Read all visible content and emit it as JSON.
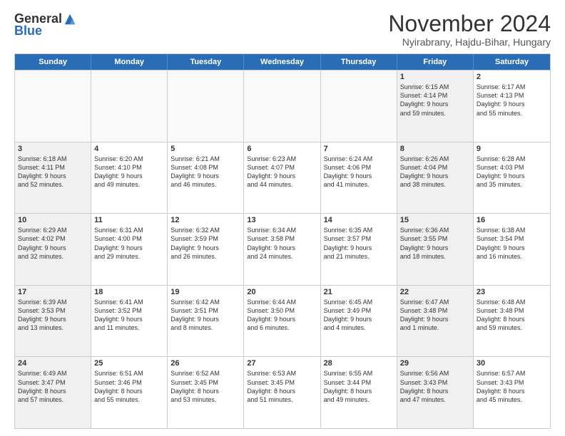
{
  "header": {
    "logo_general": "General",
    "logo_blue": "Blue",
    "title": "November 2024",
    "location": "Nyirabrany, Hajdu-Bihar, Hungary"
  },
  "weekdays": [
    "Sunday",
    "Monday",
    "Tuesday",
    "Wednesday",
    "Thursday",
    "Friday",
    "Saturday"
  ],
  "rows": [
    [
      {
        "day": "",
        "info": "",
        "empty": true
      },
      {
        "day": "",
        "info": "",
        "empty": true
      },
      {
        "day": "",
        "info": "",
        "empty": true
      },
      {
        "day": "",
        "info": "",
        "empty": true
      },
      {
        "day": "",
        "info": "",
        "empty": true
      },
      {
        "day": "1",
        "info": "Sunrise: 6:15 AM\nSunset: 4:14 PM\nDaylight: 9 hours\nand 59 minutes.",
        "shaded": true
      },
      {
        "day": "2",
        "info": "Sunrise: 6:17 AM\nSunset: 4:13 PM\nDaylight: 9 hours\nand 55 minutes."
      }
    ],
    [
      {
        "day": "3",
        "info": "Sunrise: 6:18 AM\nSunset: 4:11 PM\nDaylight: 9 hours\nand 52 minutes.",
        "shaded": true
      },
      {
        "day": "4",
        "info": "Sunrise: 6:20 AM\nSunset: 4:10 PM\nDaylight: 9 hours\nand 49 minutes."
      },
      {
        "day": "5",
        "info": "Sunrise: 6:21 AM\nSunset: 4:08 PM\nDaylight: 9 hours\nand 46 minutes."
      },
      {
        "day": "6",
        "info": "Sunrise: 6:23 AM\nSunset: 4:07 PM\nDaylight: 9 hours\nand 44 minutes."
      },
      {
        "day": "7",
        "info": "Sunrise: 6:24 AM\nSunset: 4:06 PM\nDaylight: 9 hours\nand 41 minutes."
      },
      {
        "day": "8",
        "info": "Sunrise: 6:26 AM\nSunset: 4:04 PM\nDaylight: 9 hours\nand 38 minutes.",
        "shaded": true
      },
      {
        "day": "9",
        "info": "Sunrise: 6:28 AM\nSunset: 4:03 PM\nDaylight: 9 hours\nand 35 minutes."
      }
    ],
    [
      {
        "day": "10",
        "info": "Sunrise: 6:29 AM\nSunset: 4:02 PM\nDaylight: 9 hours\nand 32 minutes.",
        "shaded": true
      },
      {
        "day": "11",
        "info": "Sunrise: 6:31 AM\nSunset: 4:00 PM\nDaylight: 9 hours\nand 29 minutes."
      },
      {
        "day": "12",
        "info": "Sunrise: 6:32 AM\nSunset: 3:59 PM\nDaylight: 9 hours\nand 26 minutes."
      },
      {
        "day": "13",
        "info": "Sunrise: 6:34 AM\nSunset: 3:58 PM\nDaylight: 9 hours\nand 24 minutes."
      },
      {
        "day": "14",
        "info": "Sunrise: 6:35 AM\nSunset: 3:57 PM\nDaylight: 9 hours\nand 21 minutes."
      },
      {
        "day": "15",
        "info": "Sunrise: 6:36 AM\nSunset: 3:55 PM\nDaylight: 9 hours\nand 18 minutes.",
        "shaded": true
      },
      {
        "day": "16",
        "info": "Sunrise: 6:38 AM\nSunset: 3:54 PM\nDaylight: 9 hours\nand 16 minutes."
      }
    ],
    [
      {
        "day": "17",
        "info": "Sunrise: 6:39 AM\nSunset: 3:53 PM\nDaylight: 9 hours\nand 13 minutes.",
        "shaded": true
      },
      {
        "day": "18",
        "info": "Sunrise: 6:41 AM\nSunset: 3:52 PM\nDaylight: 9 hours\nand 11 minutes."
      },
      {
        "day": "19",
        "info": "Sunrise: 6:42 AM\nSunset: 3:51 PM\nDaylight: 9 hours\nand 8 minutes."
      },
      {
        "day": "20",
        "info": "Sunrise: 6:44 AM\nSunset: 3:50 PM\nDaylight: 9 hours\nand 6 minutes."
      },
      {
        "day": "21",
        "info": "Sunrise: 6:45 AM\nSunset: 3:49 PM\nDaylight: 9 hours\nand 4 minutes."
      },
      {
        "day": "22",
        "info": "Sunrise: 6:47 AM\nSunset: 3:48 PM\nDaylight: 9 hours\nand 1 minute.",
        "shaded": true
      },
      {
        "day": "23",
        "info": "Sunrise: 6:48 AM\nSunset: 3:48 PM\nDaylight: 8 hours\nand 59 minutes."
      }
    ],
    [
      {
        "day": "24",
        "info": "Sunrise: 6:49 AM\nSunset: 3:47 PM\nDaylight: 8 hours\nand 57 minutes.",
        "shaded": true
      },
      {
        "day": "25",
        "info": "Sunrise: 6:51 AM\nSunset: 3:46 PM\nDaylight: 8 hours\nand 55 minutes."
      },
      {
        "day": "26",
        "info": "Sunrise: 6:52 AM\nSunset: 3:45 PM\nDaylight: 8 hours\nand 53 minutes."
      },
      {
        "day": "27",
        "info": "Sunrise: 6:53 AM\nSunset: 3:45 PM\nDaylight: 8 hours\nand 51 minutes."
      },
      {
        "day": "28",
        "info": "Sunrise: 6:55 AM\nSunset: 3:44 PM\nDaylight: 8 hours\nand 49 minutes."
      },
      {
        "day": "29",
        "info": "Sunrise: 6:56 AM\nSunset: 3:43 PM\nDaylight: 8 hours\nand 47 minutes.",
        "shaded": true
      },
      {
        "day": "30",
        "info": "Sunrise: 6:57 AM\nSunset: 3:43 PM\nDaylight: 8 hours\nand 45 minutes."
      }
    ]
  ]
}
